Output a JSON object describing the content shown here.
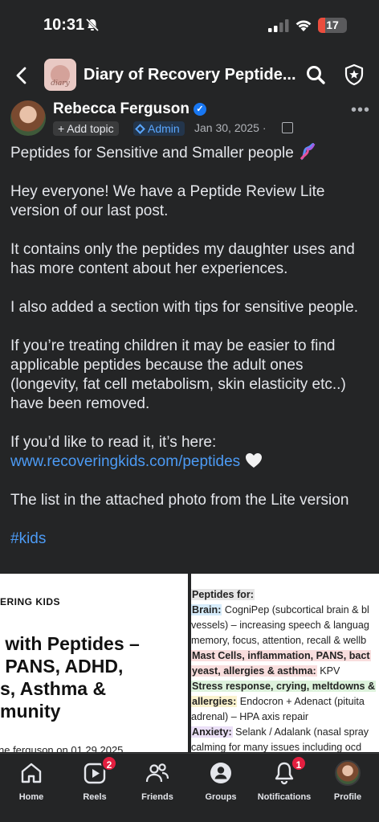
{
  "status": {
    "time": "10:31",
    "battery": "17"
  },
  "header": {
    "title": "Diary of Recovery Peptide...",
    "thumb_text": "diary",
    "icons": [
      "back-icon",
      "search-icon",
      "shield-star-icon"
    ]
  },
  "post": {
    "author": "Rebecca Ferguson",
    "add_topic": "+ Add topic",
    "admin": "Admin",
    "date": "Jan 30, 2025 ·",
    "paragraphs": [
      "Peptides for Sensitive and Smaller people",
      "Hey everyone! We have a Peptide Review Lite version of our last post.",
      "It contains only the peptides my daughter uses and has more content about her experiences.",
      "I also added a section with tips for sensitive people.",
      "If you’re treating children it may be easier to find applicable peptides because the adult ones (longevity, fat cell metabolism, skin elasticity etc..) have been removed.",
      "If you’d like to read it, it’s here:",
      "The list in the attached photo from the Lite version"
    ],
    "link": "www.recoveringkids.com/peptides",
    "hashtag": "#kids"
  },
  "image_left": {
    "brand": "ERING KIDS",
    "headline": " with Peptides –\n PANS, ADHD,\ns, Asthma &\nmunity",
    "byline": "ne ferguson on 01.29.2025"
  },
  "image_right": {
    "lines": [
      {
        "head": "Peptides for:",
        "text": "",
        "color": "#e6e6e6"
      },
      {
        "head": "Brain:",
        "text": " CogniPep (subcortical brain & bl",
        "color": "#d6ecfb"
      },
      {
        "head": "",
        "text": "vessels) – increasing speech & languag",
        "color": ""
      },
      {
        "head": "",
        "text": "memory, focus, attention, recall & wellb",
        "color": ""
      },
      {
        "head": "Mast Cells, inflammation, PANS, bact",
        "text": "",
        "color": "#f9dede"
      },
      {
        "head": "yeast, allergies & asthma:",
        "text": " KPV",
        "color": "#f9dede"
      },
      {
        "head": "Stress response, crying, meltdowns &",
        "text": "",
        "color": "#ddf2dc"
      },
      {
        "head": "allergies:",
        "text": " Endocron + Adenact (pituita",
        "color": "#fbf3cf"
      },
      {
        "head": "",
        "text": "adrenal) – HPA axis repair",
        "color": ""
      },
      {
        "head": "Anxiety:",
        "text": " Selank / Adalank (nasal spray",
        "color": "#ebe0f7"
      },
      {
        "head": "",
        "text": "calming for many issues including ocd",
        "color": ""
      }
    ]
  },
  "tabs": [
    {
      "label": "Home",
      "icon": "home-icon",
      "badge": ""
    },
    {
      "label": "Reels",
      "icon": "reels-icon",
      "badge": "2"
    },
    {
      "label": "Friends",
      "icon": "friends-icon",
      "badge": ""
    },
    {
      "label": "Groups",
      "icon": "groups-icon",
      "badge": ""
    },
    {
      "label": "Notifications",
      "icon": "bell-icon",
      "badge": "1"
    },
    {
      "label": "Profile",
      "icon": "profile-avatar",
      "badge": ""
    }
  ],
  "colors": {
    "background": "#242526",
    "link": "#4c9bf5",
    "badge": "#e41e3f",
    "verified": "#1877f2"
  }
}
